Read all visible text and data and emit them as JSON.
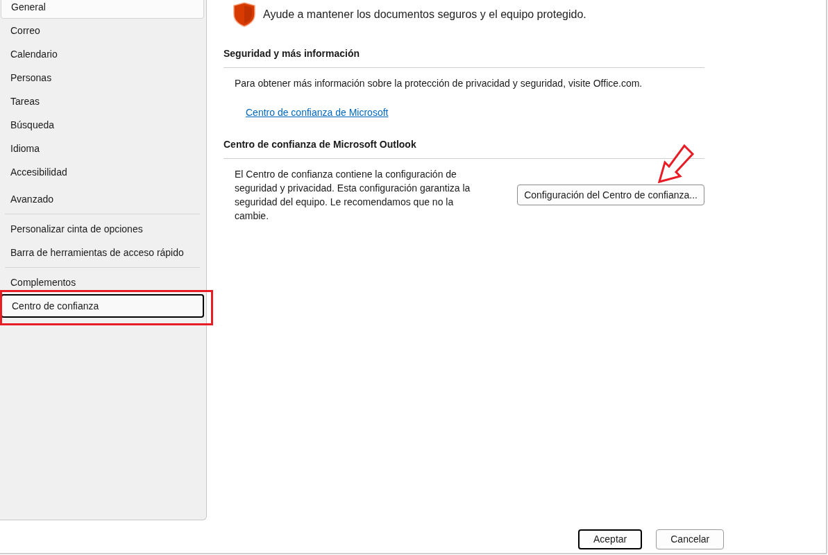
{
  "sidebar": {
    "groups": [
      [
        {
          "label": "General",
          "selected": false,
          "hovered": true
        },
        {
          "label": "Correo",
          "selected": false,
          "hovered": false
        },
        {
          "label": "Calendario",
          "selected": false,
          "hovered": false
        },
        {
          "label": "Personas",
          "selected": false,
          "hovered": false
        },
        {
          "label": "Tareas",
          "selected": false,
          "hovered": false
        },
        {
          "label": "Búsqueda",
          "selected": false,
          "hovered": false
        },
        {
          "label": "Idioma",
          "selected": false,
          "hovered": false
        },
        {
          "label": "Accesibilidad",
          "selected": false,
          "hovered": false
        },
        {
          "label": "Avanzado",
          "selected": false,
          "hovered": false
        }
      ],
      [
        {
          "label": "Personalizar cinta de opciones",
          "selected": false,
          "hovered": false
        },
        {
          "label": "Barra de herramientas de acceso rápido",
          "selected": false,
          "hovered": false
        }
      ],
      [
        {
          "label": "Complementos",
          "selected": false,
          "hovered": false
        },
        {
          "label": "Centro de confianza",
          "selected": true,
          "hovered": false
        }
      ]
    ]
  },
  "main": {
    "intro": "Ayude a mantener los documentos seguros y el equipo protegido.",
    "sections": [
      {
        "heading": "Seguridad y más información",
        "text": "Para obtener más información sobre la protección de privacidad y seguridad, visite Office.com.",
        "link": "Centro de confianza de Microsoft"
      },
      {
        "heading": "Centro de confianza de Microsoft Outlook",
        "text": "El Centro de confianza contiene la configuración de seguridad y privacidad. Esta configuración garantiza la seguridad del equipo. Le recomendamos que no la cambie.",
        "button": "Configuración del Centro de confianza..."
      }
    ]
  },
  "buttons": [
    {
      "label": "Aceptar",
      "default": true
    },
    {
      "label": "Cancelar",
      "default": false
    }
  ]
}
